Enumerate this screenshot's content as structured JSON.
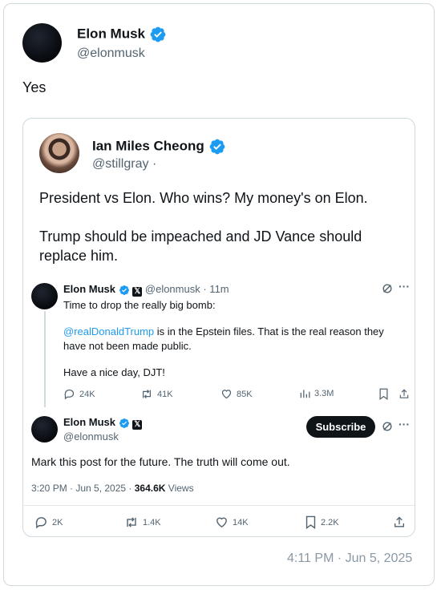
{
  "post": {
    "author": "Elon Musk",
    "handle": "@elonmusk",
    "text": "Yes",
    "timestamp": "4:11 PM · Jun 5, 2025"
  },
  "quoted": {
    "author": "Ian Miles Cheong",
    "handle": "@stillgray",
    "handle_dot": "·",
    "paragraphs": [
      "President vs Elon. Who wins? My money's on Elon.",
      "Trump should be impeached and JD Vance should replace him."
    ]
  },
  "thread": {
    "first": {
      "author": "Elon Musk",
      "handle": "@elonmusk",
      "age": "· 11m",
      "line1": "Time to drop the really big bomb:",
      "mention": "@realDonaldTrump",
      "line2": " is in the Epstein files. That is the real reason they have not been made public.",
      "line3": "Have a nice day, DJT!",
      "replies": "24K",
      "reposts": "41K",
      "likes": "85K",
      "views": "3.3M"
    },
    "second": {
      "author": "Elon Musk",
      "handle": "@elonmusk",
      "subscribe": "Subscribe",
      "text": "Mark this post for the future. The truth will come out.",
      "time": "3:20 PM · Jun 5, 2025 · ",
      "views_count": "364.6K",
      "views_label": " Views"
    },
    "bottom": {
      "replies": "2K",
      "reposts": "1.4K",
      "likes": "14K",
      "bookmarks": "2.2K"
    }
  },
  "colors": {
    "accent": "#1d9bf0",
    "text": "#0f1419",
    "muted": "#536471"
  }
}
